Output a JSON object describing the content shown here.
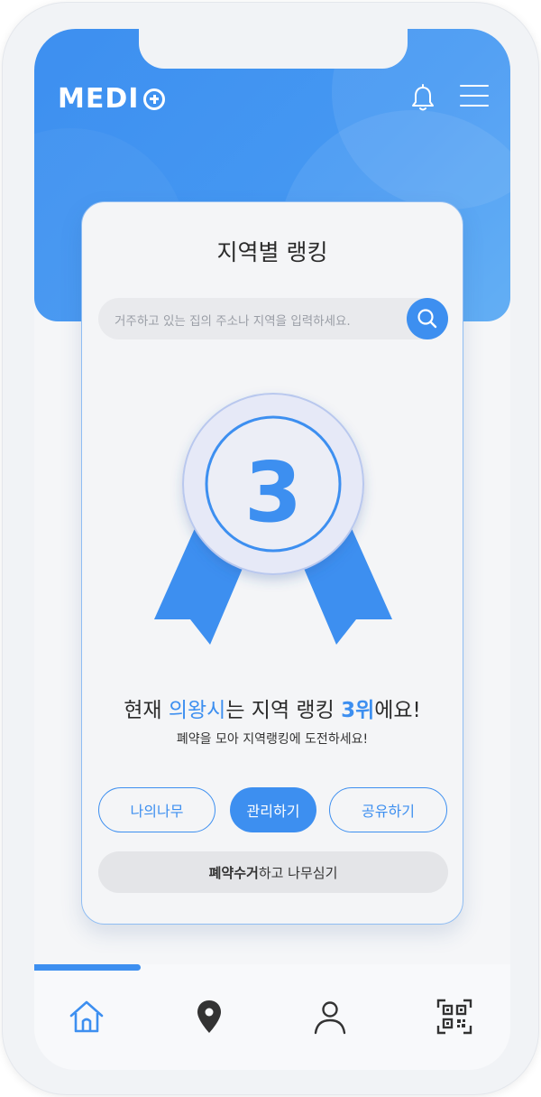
{
  "app": {
    "logo_text": "MEDI"
  },
  "header": {
    "bell_icon": "bell-icon",
    "menu_icon": "hamburger-menu-icon"
  },
  "card": {
    "title": "지역별 랭킹",
    "search": {
      "placeholder": "거주하고 있는 집의 주소나 지역을 입력하세요.",
      "icon": "search-icon"
    },
    "medal": {
      "rank_number": "3"
    },
    "rank_sentence": {
      "prefix": "현재 ",
      "region": "의왕시",
      "middle": "는 지역 랭킹 ",
      "rank": "3위",
      "suffix": "에요!"
    },
    "subtitle": "폐약을 모아 지역랭킹에 도전하세요!",
    "buttons": {
      "my_tree": "나의나무",
      "manage": "관리하기",
      "share": "공유하기"
    },
    "collect_button": {
      "bold": "폐약수거",
      "rest": "하고 나무심기"
    }
  },
  "tabbar": {
    "items": [
      {
        "name": "home",
        "icon": "home-icon",
        "active": true
      },
      {
        "name": "location",
        "icon": "location-pin-icon",
        "active": false
      },
      {
        "name": "profile",
        "icon": "user-icon",
        "active": false
      },
      {
        "name": "qr",
        "icon": "qr-code-icon",
        "active": false
      }
    ]
  },
  "colors": {
    "accent": "#3d8ff0",
    "background": "#f5f6f8",
    "text": "#2b2b2b"
  }
}
